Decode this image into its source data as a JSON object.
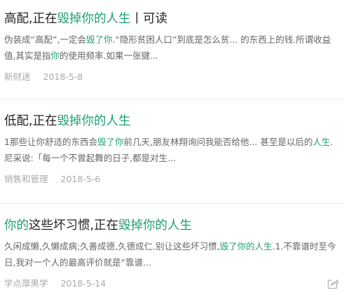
{
  "results": [
    {
      "title_parts": [
        {
          "text": "高配,正在",
          "hl": false
        },
        {
          "text": "毁掉你的人生",
          "hl": true
        },
        {
          "text": "丨可读",
          "hl": false
        }
      ],
      "snippet_parts": [
        {
          "text": "伪装成“高配”,一定会",
          "hl": false
        },
        {
          "text": "毁了你",
          "hl": true
        },
        {
          "text": ".“隐形贫困人口”到底是怎么贫... 的东西上的钱.所谓收益值,其实是指",
          "hl": false
        },
        {
          "text": "你",
          "hl": true
        },
        {
          "text": "的使用频率.如果一张键...",
          "hl": false
        }
      ],
      "source": "新财迷",
      "date": "2018-5-8",
      "has_share": false
    },
    {
      "title_parts": [
        {
          "text": "低配,正在",
          "hl": false
        },
        {
          "text": "毁掉你的人生",
          "hl": true
        }
      ],
      "snippet_parts": [
        {
          "text": "1那些让你舒适的东西会",
          "hl": false
        },
        {
          "text": "毁了你",
          "hl": true
        },
        {
          "text": "前几天,朋友林翔询问我能否给他... 甚至是以后的",
          "hl": false
        },
        {
          "text": "人生",
          "hl": true
        },
        {
          "text": ". 尼采说:「每一个不曾起舞的日子,都是对生...",
          "hl": false
        }
      ],
      "source": "销售和管理",
      "date": "2018-5-6",
      "has_share": false
    },
    {
      "title_parts": [
        {
          "text": "你的",
          "hl": true
        },
        {
          "text": "这些坏习惯,正在",
          "hl": false
        },
        {
          "text": "毁掉你的人生",
          "hl": true
        }
      ],
      "snippet_parts": [
        {
          "text": "久闲成懒,久懒成病;久善成德,久德成仁.别让这些坏习惯,",
          "hl": false
        },
        {
          "text": "毁了你的人生",
          "hl": true
        },
        {
          "text": ".1.不靠谱时至今日,我对一个人的最高评价就是“靠谱...",
          "hl": false
        }
      ],
      "source": "学点厚黑学",
      "date": "2018-5-14",
      "has_share": true
    }
  ],
  "colors": {
    "highlight": "#1f9e6f",
    "title": "#222222",
    "snippet": "#666666",
    "meta": "#aaaaaa"
  },
  "icons": {
    "share": "share-icon"
  }
}
